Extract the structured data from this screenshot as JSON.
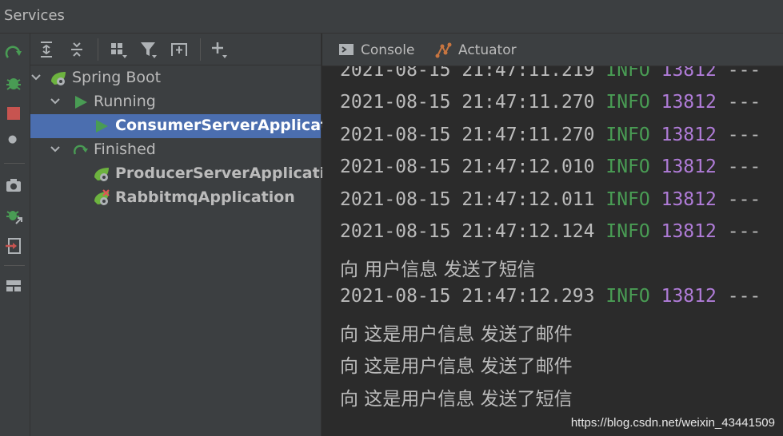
{
  "window": {
    "title": "Services"
  },
  "tree": {
    "nodes": [
      {
        "label": "Spring Boot"
      },
      {
        "label": "Running"
      },
      {
        "label": "ConsumerServerApplication"
      },
      {
        "label": "Finished"
      },
      {
        "label": "ProducerServerApplication"
      },
      {
        "label": "RabbitmqApplication"
      }
    ]
  },
  "tabs": [
    {
      "label": "Console",
      "icon": "console-icon"
    },
    {
      "label": "Actuator",
      "icon": "actuator-icon"
    }
  ],
  "log": [
    {
      "ts": "2021-08-15 21:47:11.219",
      "level": "INFO",
      "pid": "13812",
      "rest": "---"
    },
    {
      "ts": "2021-08-15 21:47:11.270",
      "level": "INFO",
      "pid": "13812",
      "rest": "---"
    },
    {
      "ts": "2021-08-15 21:47:11.270",
      "level": "INFO",
      "pid": "13812",
      "rest": "---"
    },
    {
      "ts": "2021-08-15 21:47:12.010",
      "level": "INFO",
      "pid": "13812",
      "rest": "---"
    },
    {
      "ts": "2021-08-15 21:47:12.011",
      "level": "INFO",
      "pid": "13812",
      "rest": "---"
    },
    {
      "ts": "2021-08-15 21:47:12.124",
      "level": "INFO",
      "pid": "13812",
      "rest": "---"
    },
    {
      "text": "向 用户信息 发送了短信"
    },
    {
      "ts": "2021-08-15 21:47:12.293",
      "level": "INFO",
      "pid": "13812",
      "rest": "---"
    },
    {
      "text": "向 这是用户信息 发送了邮件"
    },
    {
      "text": "向 这是用户信息 发送了邮件"
    },
    {
      "text": "向 这是用户信息 发送了短信"
    }
  ],
  "watermark": "https://blog.csdn.net/weixin_43441509",
  "colors": {
    "selection": "#4b6eaf",
    "info": "#499c54",
    "pid": "#b07cd8",
    "run_green": "#499c54"
  }
}
